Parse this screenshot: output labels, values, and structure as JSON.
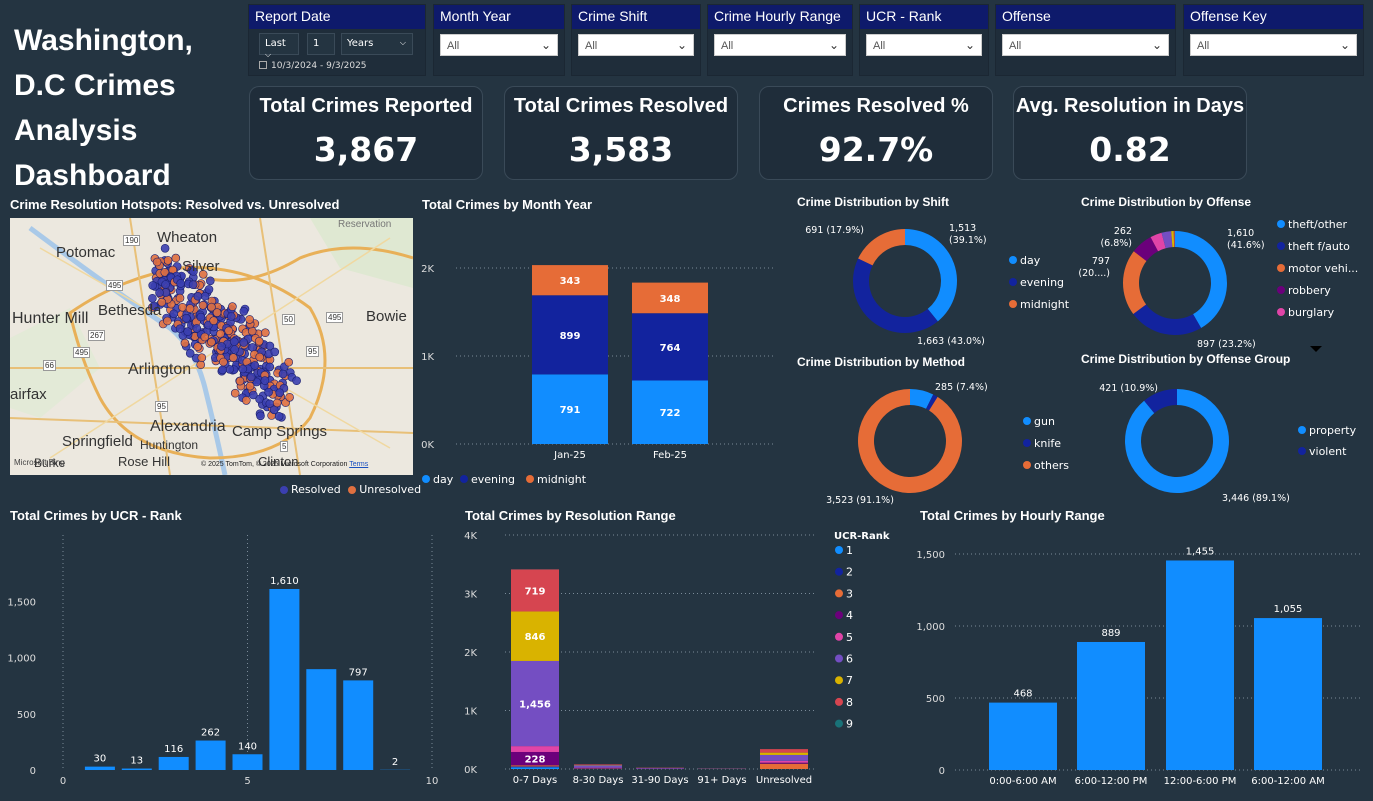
{
  "title": "Washington, D.C Crimes Analysis Dashboard",
  "slicers": {
    "report_date": {
      "label": "Report Date",
      "period": "Last",
      "count": "1",
      "unit": "Years",
      "range": "10/3/2024 - 9/3/2025"
    },
    "month_year": {
      "label": "Month Year",
      "value": "All"
    },
    "crime_shift": {
      "label": "Crime Shift",
      "value": "All"
    },
    "hourly_range": {
      "label": "Crime Hourly Range",
      "value": "All"
    },
    "ucr_rank": {
      "label": "UCR - Rank",
      "value": "All"
    },
    "offense": {
      "label": "Offense",
      "value": "All"
    },
    "offense_key": {
      "label": "Offense Key",
      "value": "All"
    }
  },
  "kpis": [
    {
      "label": "Total Crimes Reported",
      "value": "3,867"
    },
    {
      "label": "Total Crimes Resolved",
      "value": "3,583"
    },
    {
      "label": "Crimes Resolved %",
      "value": "92.7%"
    },
    {
      "label": "Avg. Resolution in Days",
      "value": "0.82"
    }
  ],
  "map": {
    "title": "Crime Resolution Hotspots: Resolved vs. Unresolved",
    "labels": [
      "Potomac",
      "Wheaton",
      "Silver",
      "Bethesda",
      "Hunter Mill",
      "Bowie",
      "Arlington",
      "airfax",
      "Alexandria",
      "Springfield",
      "Huntington",
      "Camp Springs",
      "Rose Hill",
      "Clinton",
      "Burke",
      "Reservation"
    ],
    "road_labels": [
      "190",
      "495",
      "267",
      "495",
      "66",
      "50",
      "495",
      "95",
      "5",
      "95"
    ],
    "copyright": "© 2025 TomTom, © 2025 Microsoft Corporation",
    "terms": "Terms",
    "brand": "Microsoft Bing",
    "legend": [
      {
        "name": "Resolved",
        "color": "#3b3fb0"
      },
      {
        "name": "Unresolved",
        "color": "#e07040"
      }
    ]
  },
  "colors": {
    "day": "#118dff",
    "evening": "#12239e",
    "midnight": "#e66c37",
    "bg": "#243441"
  },
  "chart_data": [
    {
      "id": "month_year",
      "type": "bar",
      "stacked": true,
      "title": "Total Crimes by Month Year",
      "categories": [
        "Jan-25",
        "Feb-25"
      ],
      "series": [
        {
          "name": "day",
          "color": "#118dff",
          "values": [
            791,
            722
          ]
        },
        {
          "name": "evening",
          "color": "#12239e",
          "values": [
            899,
            764
          ]
        },
        {
          "name": "midnight",
          "color": "#e66c37",
          "values": [
            343,
            348
          ]
        }
      ],
      "ylim": [
        0,
        2000
      ],
      "yticks": [
        "0K",
        "1K",
        "2K"
      ],
      "grid": true,
      "legend": "bottom"
    },
    {
      "id": "shift",
      "type": "pie",
      "donut": true,
      "title": "Crime Distribution by Shift",
      "slices": [
        {
          "name": "day",
          "value": 1513,
          "label": "1,513 (39.1%)",
          "color": "#118dff"
        },
        {
          "name": "evening",
          "value": 1663,
          "label": "1,663 (43.0%)",
          "color": "#12239e"
        },
        {
          "name": "midnight",
          "value": 691,
          "label": "691 (17.9%)",
          "color": "#e66c37"
        }
      ],
      "legend": "right"
    },
    {
      "id": "offense",
      "type": "pie",
      "donut": true,
      "title": "Crime Distribution by Offense",
      "slices": [
        {
          "name": "theft/other",
          "value": 1610,
          "label": "1,610 (41.6%)",
          "color": "#118dff"
        },
        {
          "name": "theft f/auto",
          "value": 897,
          "label": "897 (23.2%)",
          "color": "#12239e"
        },
        {
          "name": "motor vehi...",
          "value": 797,
          "label": "797 (20....)",
          "color": "#e66c37"
        },
        {
          "name": "robbery",
          "value": 262,
          "label": "262 (6.8%)",
          "color": "#6b007b"
        },
        {
          "name": "burglary",
          "value": 140,
          "label": "",
          "color": "#e044a7"
        },
        {
          "name": "other1",
          "value": 116,
          "label": "",
          "color": "#744ec2",
          "legend": false
        },
        {
          "name": "other2",
          "value": 30,
          "label": "",
          "color": "#d9b300",
          "legend": false
        },
        {
          "name": "other3",
          "value": 13,
          "label": "",
          "color": "#d64550",
          "legend": false
        },
        {
          "name": "other4",
          "value": 2,
          "label": "",
          "color": "#197278",
          "legend": false
        }
      ],
      "legend": "right"
    },
    {
      "id": "method",
      "type": "pie",
      "donut": true,
      "title": "Crime Distribution by Method",
      "slices": [
        {
          "name": "gun",
          "value": 285,
          "label": "285 (7.4%)",
          "color": "#118dff"
        },
        {
          "name": "knife",
          "value": 59,
          "label": "",
          "color": "#12239e"
        },
        {
          "name": "others",
          "value": 3523,
          "label": "3,523 (91.1%)",
          "color": "#e66c37"
        }
      ],
      "legend": "right"
    },
    {
      "id": "offense_group",
      "type": "pie",
      "donut": true,
      "title": "Crime Distribution by Offense Group",
      "slices": [
        {
          "name": "property",
          "value": 3446,
          "label": "3,446 (89.1%)",
          "color": "#118dff"
        },
        {
          "name": "violent",
          "value": 421,
          "label": "421 (10.9%)",
          "color": "#12239e"
        }
      ],
      "legend": "right"
    },
    {
      "id": "ucr_rank",
      "type": "bar",
      "title": "Total Crimes by UCR - Rank",
      "x": [
        1,
        2,
        3,
        4,
        5,
        6,
        7,
        8,
        9
      ],
      "values": [
        30,
        13,
        116,
        262,
        140,
        1610,
        897,
        797,
        2
      ],
      "value_labels": [
        "30",
        "13",
        "116",
        "262",
        "140",
        "1,610",
        "",
        "797",
        "2"
      ],
      "xlim": [
        0,
        10
      ],
      "xticks": [
        "0",
        "5",
        "10"
      ],
      "ylim": [
        0,
        1700
      ],
      "yticks": [
        "0",
        "500",
        "1,000",
        "1,500"
      ],
      "color": "#118dff"
    },
    {
      "id": "resolution_range",
      "type": "bar",
      "stacked": true,
      "title": "Total Crimes by Resolution Range",
      "categories": [
        "0-7 Days",
        "8-30 Days",
        "31-90 Days",
        "91+ Days",
        "Unresolved"
      ],
      "legend_title": "UCR-Rank",
      "series": [
        {
          "name": "1",
          "color": "#118dff",
          "values": [
            30,
            3,
            1,
            0,
            0
          ],
          "labels": [
            "",
            "",
            "",
            "",
            ""
          ]
        },
        {
          "name": "2",
          "color": "#12239e",
          "values": [
            13,
            0,
            0,
            0,
            0
          ],
          "labels": [
            "",
            "",
            "",
            "",
            ""
          ]
        },
        {
          "name": "3",
          "color": "#e66c37",
          "values": [
            20,
            5,
            2,
            1,
            90
          ],
          "labels": [
            "",
            "",
            "",
            "",
            ""
          ]
        },
        {
          "name": "4",
          "color": "#6b007b",
          "values": [
            228,
            10,
            4,
            2,
            18
          ],
          "labels": [
            "228",
            "",
            "",
            "",
            ""
          ]
        },
        {
          "name": "5",
          "color": "#e044a7",
          "values": [
            100,
            5,
            2,
            1,
            32
          ],
          "labels": [
            "",
            "",
            "",
            "",
            ""
          ]
        },
        {
          "name": "6",
          "color": "#744ec2",
          "values": [
            1456,
            40,
            10,
            4,
            100
          ],
          "labels": [
            "1,456",
            "",
            "",
            "",
            ""
          ]
        },
        {
          "name": "7",
          "color": "#d9b300",
          "values": [
            846,
            6,
            2,
            1,
            40
          ],
          "labels": [
            "846",
            "",
            "",
            "",
            ""
          ]
        },
        {
          "name": "8",
          "color": "#d64550",
          "values": [
            719,
            10,
            3,
            1,
            60
          ],
          "labels": [
            "719",
            "",
            "",
            "",
            ""
          ]
        },
        {
          "name": "9",
          "color": "#197278",
          "values": [
            2,
            0,
            0,
            0,
            0
          ],
          "labels": [
            "",
            "",
            "",
            "",
            ""
          ]
        }
      ],
      "ylim": [
        0,
        4000
      ],
      "yticks": [
        "0K",
        "1K",
        "2K",
        "3K",
        "4K"
      ],
      "legend": "right"
    },
    {
      "id": "hourly_range",
      "type": "bar",
      "title": "Total Crimes by Hourly Range",
      "categories": [
        "0:00-6:00 AM",
        "6:00-12:00 PM",
        "12:00-6:00 PM",
        "6:00-12:00 AM"
      ],
      "values": [
        468,
        889,
        1455,
        1055
      ],
      "value_labels": [
        "468",
        "889",
        "1,455",
        "1,055"
      ],
      "ylim": [
        0,
        1500
      ],
      "yticks": [
        "0",
        "500",
        "1,000",
        "1,500"
      ],
      "color": "#118dff"
    }
  ]
}
